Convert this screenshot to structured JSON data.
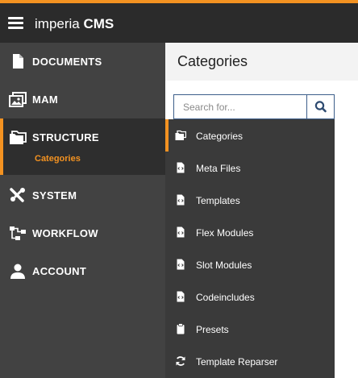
{
  "header": {
    "brand_light": "imperia",
    "brand_bold": "CMS",
    "accent_color": "#f39221"
  },
  "sidebar": {
    "items": [
      {
        "label": "DOCUMENTS",
        "icon": "document-icon"
      },
      {
        "label": "MAM",
        "icon": "image-gallery-icon"
      },
      {
        "label": "STRUCTURE",
        "icon": "folders-icon",
        "active": true,
        "sub_label": "Categories"
      },
      {
        "label": "SYSTEM",
        "icon": "tools-icon"
      },
      {
        "label": "WORKFLOW",
        "icon": "workflow-icon"
      },
      {
        "label": "ACCOUNT",
        "icon": "user-icon"
      }
    ]
  },
  "main": {
    "title": "Categories",
    "search": {
      "placeholder": "Search for...",
      "value": "",
      "icon": "search-icon"
    }
  },
  "dropdown": {
    "items": [
      {
        "label": "Categories",
        "icon": "folders-icon",
        "active": true
      },
      {
        "label": "Meta Files",
        "icon": "code-file-icon"
      },
      {
        "label": "Templates",
        "icon": "code-file-icon"
      },
      {
        "label": "Flex Modules",
        "icon": "code-file-icon"
      },
      {
        "label": "Slot Modules",
        "icon": "code-file-icon"
      },
      {
        "label": "Codeincludes",
        "icon": "code-file-icon"
      },
      {
        "label": "Presets",
        "icon": "clipboard-icon"
      },
      {
        "label": "Template Reparser",
        "icon": "refresh-icon"
      }
    ]
  }
}
